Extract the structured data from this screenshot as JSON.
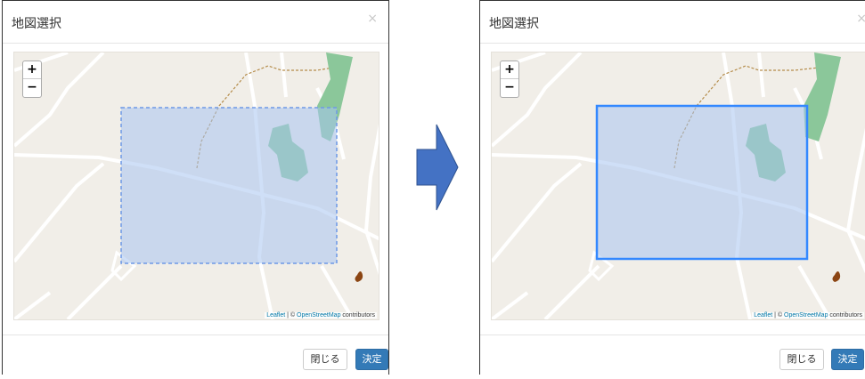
{
  "before": {
    "title": "地図選択",
    "close_symbol": "×",
    "zoom_in": "+",
    "zoom_out": "−",
    "attribution": {
      "leaflet": "Leaflet",
      "separator": " | © ",
      "osm": "OpenStreetMap",
      "suffix": " contributors"
    },
    "buttons": {
      "close": "閉じる",
      "ok": "決定"
    },
    "selection_state": "editing (dashed outline)"
  },
  "after": {
    "title": "地図選択",
    "close_symbol": "×",
    "zoom_in": "+",
    "zoom_out": "−",
    "attribution": {
      "leaflet": "Leaflet",
      "separator": " | © ",
      "osm": "OpenStreetMap",
      "suffix": " contributors"
    },
    "buttons": {
      "close": "閉じる",
      "ok": "決定"
    },
    "selection_state": "confirmed (solid outline)"
  },
  "colors": {
    "map_background": "#f1eee8",
    "road": "#ffffff",
    "selection_fill": "#a8c4f0",
    "selection_stroke": "#3388ff",
    "park": "#8bc79a",
    "primary_button": "#337ab7",
    "arrow": "#4472c4"
  },
  "icons": {
    "arrow": "right-arrow-icon",
    "campfire": "campfire-icon"
  }
}
